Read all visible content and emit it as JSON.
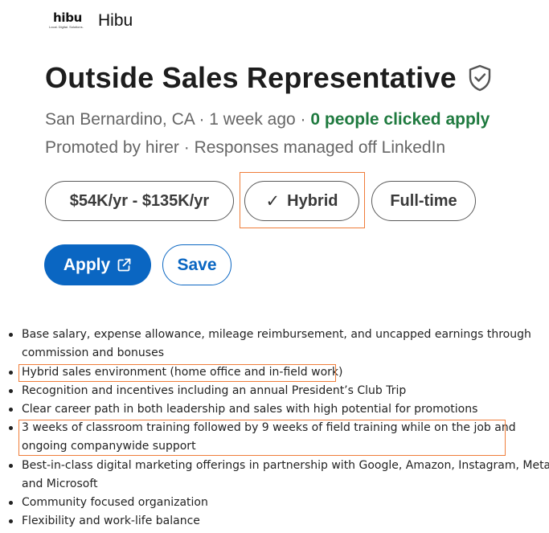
{
  "company": {
    "logo_text": "hibu",
    "logo_tagline": "Local. Digital. Solutions.",
    "name": "Hibu"
  },
  "job": {
    "title": "Outside Sales Representative",
    "location": "San Bernardino, CA",
    "posted": "1 week ago",
    "separator": " · ",
    "clicked_apply": "0 people clicked apply",
    "promoted": "Promoted by hirer",
    "responses": "Responses managed off LinkedIn"
  },
  "pills": {
    "salary": "$54K/yr - $135K/yr",
    "hybrid_check": "✓",
    "hybrid": "Hybrid",
    "employment": "Full-time"
  },
  "actions": {
    "apply_label": "Apply",
    "save_label": "Save"
  },
  "bullets": {
    "line1": "Base salary, expense allowance, mileage reimbursement, and uncapped earnings through",
    "line2": "commission and bonuses",
    "line3": "Hybrid sales environment (home office and in-field work)",
    "line4": "Recognition and incentives including an annual President’s Club Trip",
    "line5": "Clear career path in both leadership and sales with high potential for promotions",
    "line6": "3 weeks of classroom training followed by 9 weeks of field training while on the job and",
    "line7": "ongoing companywide support",
    "line8": "Best-in-class digital marketing offerings in partnership with Google, Amazon, Instagram, Meta,",
    "line9": "and Microsoft",
    "line10": "Community focused organization",
    "line11": "Flexibility and work-life balance"
  },
  "colors": {
    "primary": "#0a66c2",
    "success_text": "#1f7a3f",
    "highlight": "#ef7d3a"
  },
  "icons": {
    "verified": "shield-check-icon",
    "external": "external-link-icon"
  }
}
